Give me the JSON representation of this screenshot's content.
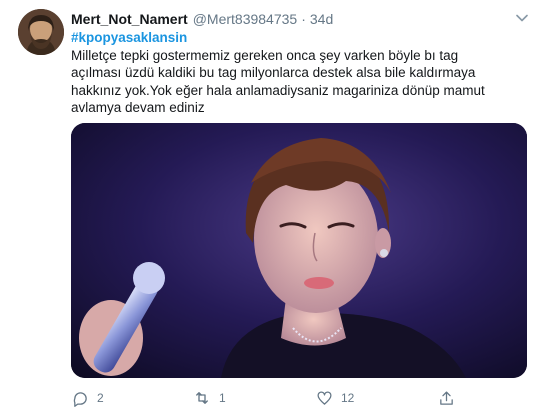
{
  "tweet": {
    "author_name": "Mert_Not_Namert",
    "author_handle": "@Mert83984735",
    "separator": "·",
    "timestamp": "34d",
    "hashtag": "#kpopyasaklansin",
    "lines": [
      "Milletçe tepki gostermemiz gereken onca şey varken böyle bı tag",
      "açılması üzdü kaldiki bu tag milyonlarca destek alsa bile kaldırmaya",
      "hakkınız yok.Yok eğer hala anlamadiysaniz magariniza dönüp mamut",
      "avlamya devam ediniz"
    ],
    "actions": {
      "reply_count": "2",
      "retweet_count": "1",
      "like_count": "12",
      "share_count": ""
    }
  },
  "icons": {
    "menu": "chevron-down-icon",
    "reply": "reply-icon",
    "retweet": "retweet-icon",
    "like": "heart-icon",
    "share": "share-icon"
  },
  "colors": {
    "hashtag": "#1b95e0",
    "secondary_text": "#657786",
    "primary_text": "#14171a"
  }
}
